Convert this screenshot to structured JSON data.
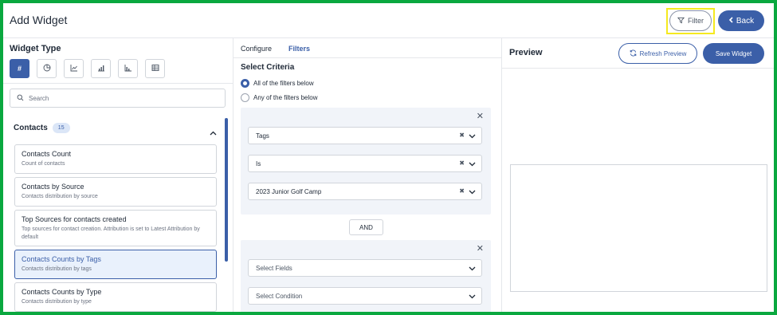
{
  "header": {
    "title": "Add Widget",
    "filter_label": "Filter",
    "back_label": "Back"
  },
  "left": {
    "widget_type_label": "Widget Type",
    "types": [
      {
        "icon": "hash-icon",
        "glyph": "#",
        "active": true
      },
      {
        "icon": "pie-chart-icon",
        "glyph": "",
        "active": false
      },
      {
        "icon": "line-chart-icon",
        "glyph": "",
        "active": false
      },
      {
        "icon": "bar-chart-icon",
        "glyph": "",
        "active": false
      },
      {
        "icon": "horizontal-bar-chart-icon",
        "glyph": "",
        "active": false
      },
      {
        "icon": "table-icon",
        "glyph": "",
        "active": false
      }
    ],
    "search_placeholder": "Search",
    "group": {
      "title": "Contacts",
      "count": "15"
    },
    "cards": [
      {
        "title": "Contacts Count",
        "desc": "Count of contacts",
        "selected": false
      },
      {
        "title": "Contacts by Source",
        "desc": "Contacts distribution by source",
        "selected": false
      },
      {
        "title": "Top Sources for contacts created",
        "desc": "Top sources for contact creation. Attribution is set to Latest Attribution by default",
        "selected": false
      },
      {
        "title": "Contacts Counts by Tags",
        "desc": "Contacts distribution by tags",
        "selected": true
      },
      {
        "title": "Contacts Counts by Type",
        "desc": "Contacts distribution by type",
        "selected": false
      }
    ]
  },
  "middle": {
    "tabs": [
      "Configure",
      "Filters"
    ],
    "active_tab": "Filters",
    "select_criteria": "Select Criteria",
    "radio_all": "All of the filters below",
    "radio_any": "Any of the filters below",
    "filter1": {
      "field": "Tags",
      "condition": "Is",
      "value": "2023 Junior Golf Camp"
    },
    "and_label": "AND",
    "filter2": {
      "field_placeholder": "Select Fields",
      "condition_placeholder": "Select Condition"
    }
  },
  "right": {
    "preview_title": "Preview",
    "refresh_label": "Refresh Preview",
    "save_label": "Save Widget"
  },
  "colors": {
    "accent": "#3b5fa8",
    "frame": "#0aa83f",
    "highlight": "#f5e91f"
  }
}
